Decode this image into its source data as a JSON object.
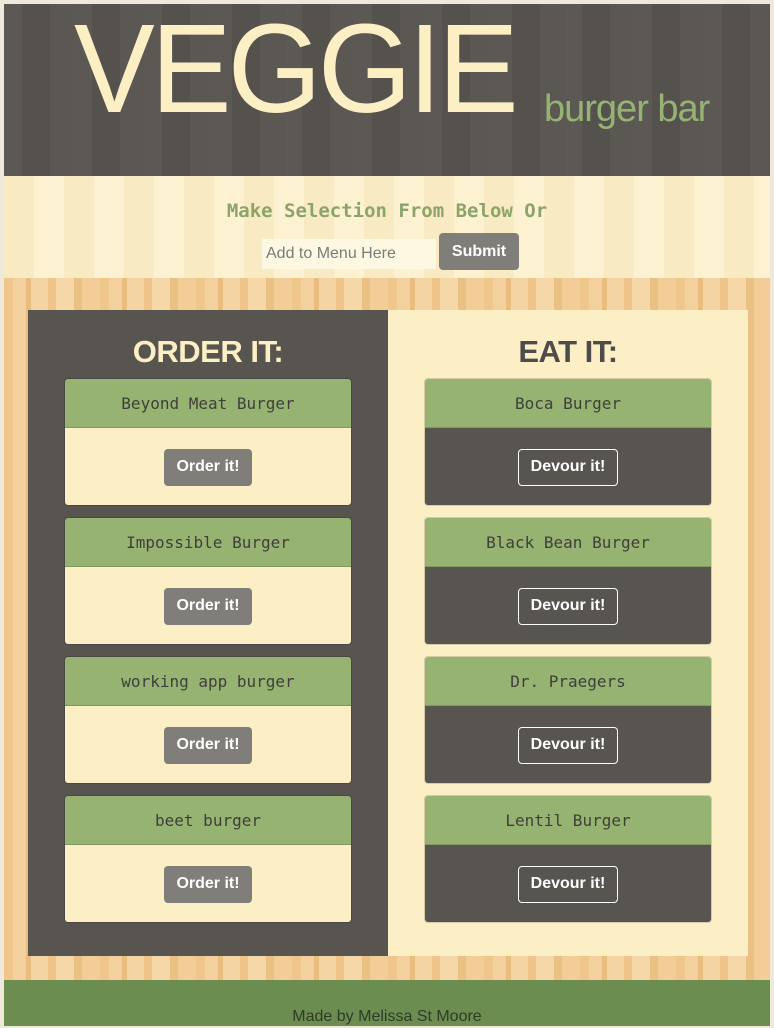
{
  "brand": {
    "main": "VEGGIE",
    "sub": "burger bar"
  },
  "form": {
    "prompt": "Make Selection From Below Or",
    "input_placeholder": "Add to Menu Here",
    "submit_label": "Submit"
  },
  "order_panel": {
    "title": "ORDER IT:",
    "items": [
      {
        "name": "Beyond Meat Burger",
        "button": "Order it!"
      },
      {
        "name": "Impossible Burger",
        "button": "Order it!"
      },
      {
        "name": "working app burger",
        "button": "Order it!"
      },
      {
        "name": "beet burger",
        "button": "Order it!"
      }
    ]
  },
  "eat_panel": {
    "title": "EAT IT:",
    "items": [
      {
        "name": "Boca Burger",
        "button": "Devour it!"
      },
      {
        "name": "Black Bean Burger",
        "button": "Devour it!"
      },
      {
        "name": "Dr. Praegers",
        "button": "Devour it!"
      },
      {
        "name": "Lentil Burger",
        "button": "Devour it!"
      }
    ]
  },
  "footer": {
    "text": "Made by Melissa St Moore"
  },
  "colors": {
    "header_bg": "#585551",
    "cream": "#fcefc6",
    "sage": "#97b372",
    "footer_green": "#6b8e50",
    "button_gray": "#807e79"
  }
}
